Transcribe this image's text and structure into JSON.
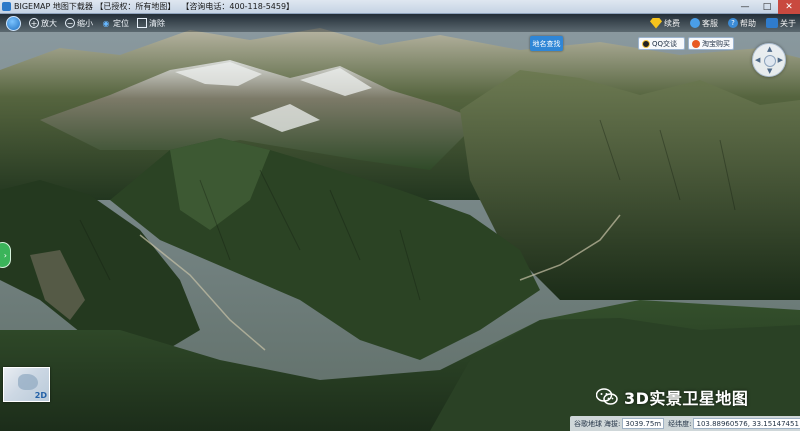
{
  "window": {
    "title": "BIGEMAP 地图下载器 【已授权：所有地图】",
    "hotline": "【咨询电话：400-118-5459】",
    "controls": {
      "minimize": "—",
      "maximize": "□",
      "close": "✕"
    }
  },
  "toolbar": {
    "items": [
      {
        "label": "放大",
        "icon": "zoom-in-icon"
      },
      {
        "label": "缩小",
        "icon": "zoom-out-icon"
      },
      {
        "label": "定位",
        "icon": "location-pin-icon"
      },
      {
        "label": "清除",
        "icon": "clear-icon"
      }
    ],
    "right": [
      {
        "label": "续费",
        "icon": "gem-icon"
      },
      {
        "label": "客服",
        "icon": "service-icon"
      },
      {
        "label": "帮助",
        "icon": "help-icon"
      },
      {
        "label": "关于",
        "icon": "about-icon"
      }
    ]
  },
  "search": {
    "label": "地名查找"
  },
  "social": {
    "qq": "QQ交谈",
    "taobao": "淘宝购买"
  },
  "minimap": {
    "mode": "2D"
  },
  "watermark": {
    "text": "3D实景卫星地图"
  },
  "status": {
    "source_label": "谷歌地球",
    "elevation_label": "海拔:",
    "elevation_value": "3039.75m",
    "coords_label": "经纬度:",
    "coords_value": "103.88960576, 33.15147451"
  },
  "colors": {
    "accent": "#2f86d6",
    "forest_dark": "#1f3320",
    "forest_mid": "#3a5a2c",
    "rock": "#8a8270",
    "snow": "#e8ecef",
    "sky_haze": "#9aa9b0"
  }
}
